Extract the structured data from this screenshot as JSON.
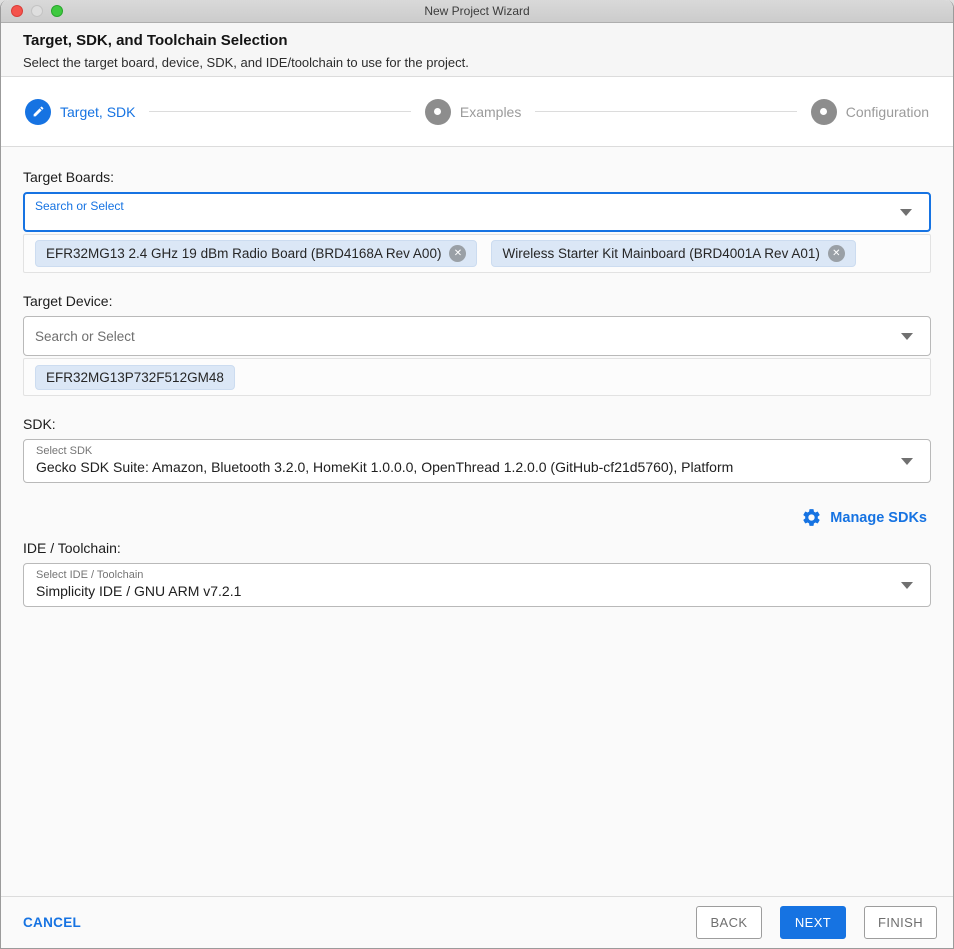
{
  "window": {
    "title": "New Project Wizard"
  },
  "header": {
    "title": "Target, SDK, and Toolchain Selection",
    "subtitle": "Select the target board, device, SDK, and IDE/toolchain to use for the project."
  },
  "stepper": {
    "steps": [
      {
        "label": "Target, SDK",
        "state": "active",
        "icon": "pencil-icon"
      },
      {
        "label": "Examples",
        "state": "inactive",
        "icon": "dot-icon"
      },
      {
        "label": "Configuration",
        "state": "inactive",
        "icon": "dot-icon"
      }
    ]
  },
  "form": {
    "target_boards": {
      "label": "Target Boards:",
      "placeholder": "Search or Select",
      "chips": [
        {
          "text": "EFR32MG13 2.4 GHz 19 dBm Radio Board (BRD4168A Rev A00)",
          "removable": true
        },
        {
          "text": "Wireless Starter Kit Mainboard (BRD4001A Rev A01)",
          "removable": true
        }
      ]
    },
    "target_device": {
      "label": "Target Device:",
      "placeholder": "Search or Select",
      "chips": [
        {
          "text": "EFR32MG13P732F512GM48",
          "removable": false
        }
      ]
    },
    "sdk": {
      "label": "SDK:",
      "select_label": "Select SDK",
      "value": "Gecko SDK Suite: Amazon, Bluetooth 3.2.0, HomeKit 1.0.0.0, OpenThread 1.2.0.0 (GitHub-cf21d5760), Platform",
      "manage_label": "Manage SDKs"
    },
    "ide_toolchain": {
      "label": "IDE / Toolchain:",
      "select_label": "Select IDE / Toolchain",
      "value": "Simplicity IDE / GNU ARM v7.2.1"
    }
  },
  "footer": {
    "cancel_label": "CANCEL",
    "back_label": "BACK",
    "next_label": "NEXT",
    "finish_label": "FINISH"
  },
  "colors": {
    "accent_blue": "#1673e2",
    "inactive_step_gray": "#8d8d8d",
    "chip_background": "#dbe7f6",
    "close_light": "#f4534c",
    "zoom_light": "#3ec93f"
  }
}
